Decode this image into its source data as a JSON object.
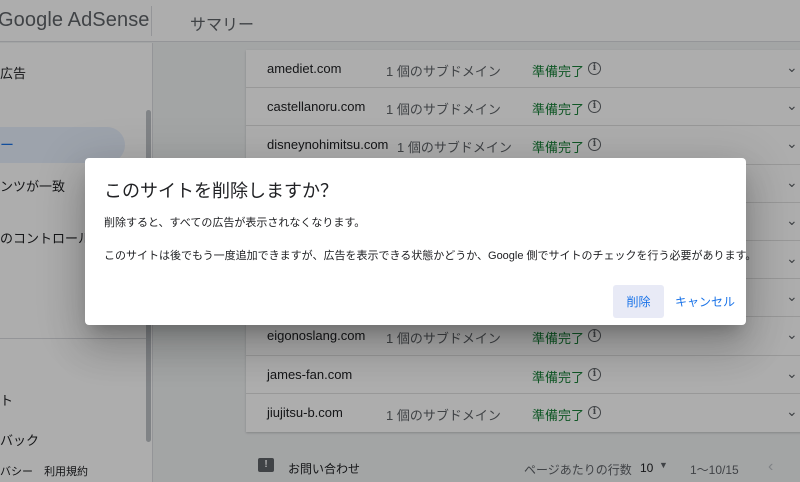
{
  "header": {
    "logo_text": "Google AdSense",
    "page_title": "サマリー"
  },
  "sidebar": {
    "items": [
      {
        "label": "広告"
      },
      {
        "label": "ー"
      },
      {
        "label": "ンツが一致"
      },
      {
        "label": "のコントロール"
      },
      {
        "label": "ト"
      },
      {
        "label": "バック"
      }
    ],
    "footer_links": [
      "バシー",
      "利用規約"
    ]
  },
  "sites": [
    {
      "domain": "amediet.com",
      "subdomains": "1 個のサブドメイン",
      "status": "準備完了",
      "info_icon": "ⓘ"
    },
    {
      "domain": "castellanoru.com",
      "subdomains": "1 個のサブドメイン",
      "status": "準備完了",
      "info_icon": "ⓘ"
    },
    {
      "domain": "disneynohimitsu.com",
      "subdomains": "1 個のサブドメイン",
      "status": "準備完了",
      "info_icon": "ⓘ"
    },
    {
      "domain": "",
      "subdomains": "",
      "status": "",
      "info_icon": ""
    },
    {
      "domain": "",
      "subdomains": "",
      "status": "",
      "info_icon": ""
    },
    {
      "domain": "",
      "subdomains": "",
      "status": "",
      "info_icon": ""
    },
    {
      "domain": "",
      "subdomains": "",
      "status": "",
      "info_icon": ""
    },
    {
      "domain": "eigonoslang.com",
      "subdomains": "1 個のサブドメイン",
      "status": "準備完了",
      "info_icon": "ⓘ"
    },
    {
      "domain": "james-fan.com",
      "subdomains": "",
      "status": "準備完了",
      "info_icon": "ⓘ"
    },
    {
      "domain": "jiujitsu-b.com",
      "subdomains": "1 個のサブドメイン",
      "status": "準備完了",
      "info_icon": "ⓘ"
    }
  ],
  "footer": {
    "feedback_label": "お問い合わせ",
    "rows_per_page_label": "ページあたりの行数",
    "rows_per_page_value": "10",
    "range_text": "1〜10/15"
  },
  "dialog": {
    "title": "このサイトを削除しますか？",
    "line1": "削除すると、すべての広告が表示されなくなります。",
    "line2": "このサイトは後でもう一度追加できますが、広告を表示できる状態かどうか、Google 側でサイトのチェックを行う必要があります。",
    "delete_label": "削除",
    "cancel_label": "キャンセル"
  },
  "colors": {
    "accent": "#1a73e8",
    "status_ready": "#188038",
    "scrim": "rgba(0,0,0,0.32)"
  }
}
